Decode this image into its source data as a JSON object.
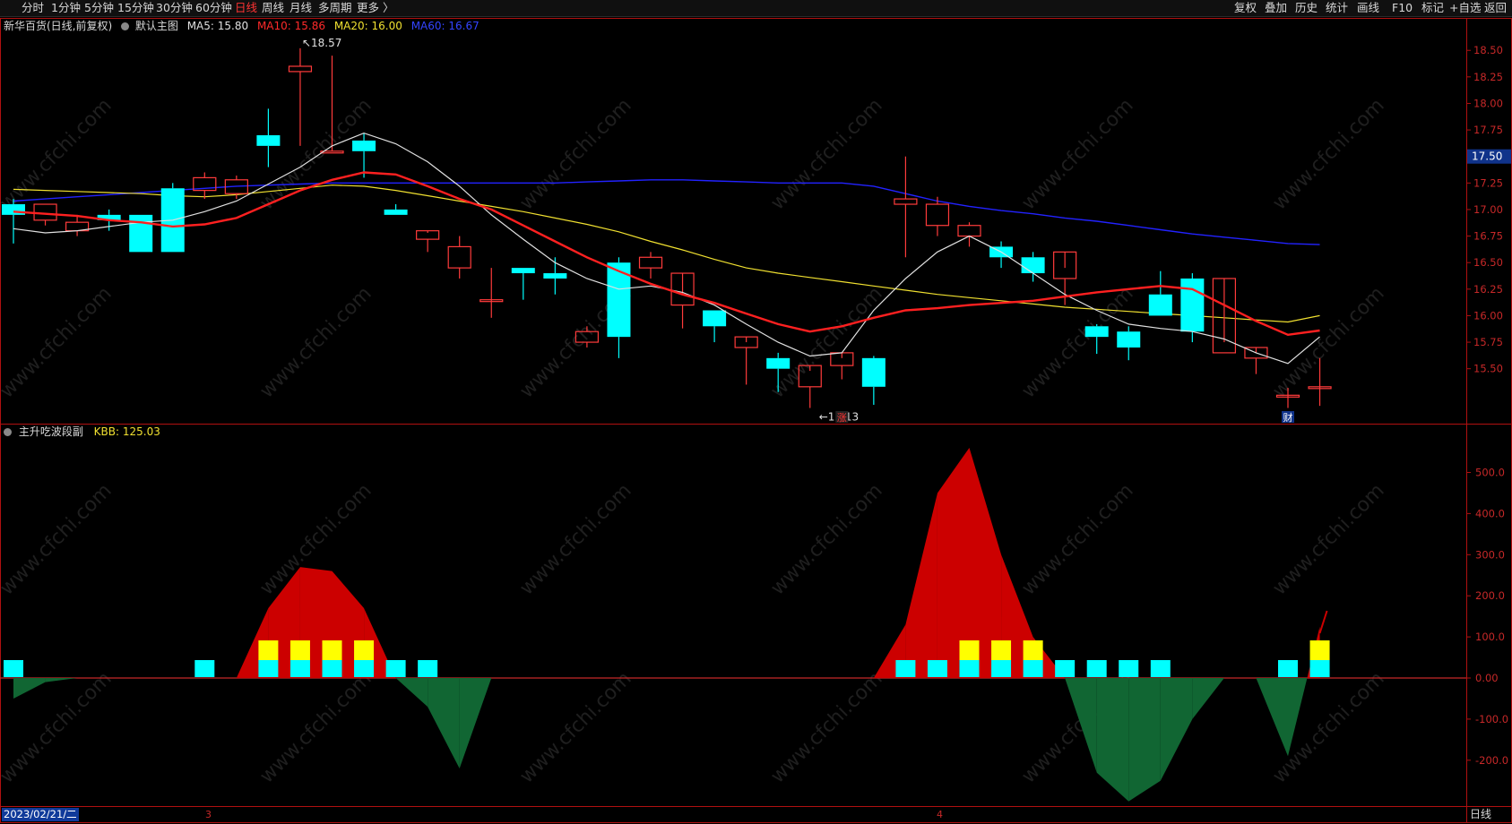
{
  "toolbar": {
    "left_items": [
      "分时",
      "1分钟",
      "5分钟",
      "15分钟",
      "30分钟",
      "60分钟",
      "日线",
      "周线",
      "月线",
      "多周期",
      "更多 〉"
    ],
    "active_index": 6,
    "right_items": [
      "复权",
      "叠加",
      "历史",
      "统计",
      "画线",
      "F10",
      "标记",
      "+自选",
      "返回"
    ]
  },
  "main_legend": {
    "title": "新华百货(日线,前复权)",
    "template_icon": "circle-icon",
    "template": "默认主图",
    "ma5": "MA5: 15.80",
    "ma10": "MA10: 15.86",
    "ma20": "MA20: 16.00",
    "ma60": "MA60: 16.67"
  },
  "sub_legend": {
    "name": "主升吃波段副",
    "kbb": "KBB: 125.03"
  },
  "colors": {
    "up": "#ff3b3b",
    "down": "#00ffff",
    "ma5": "#e0e0e0",
    "ma10": "#ff2020",
    "ma20": "#f0e030",
    "ma60": "#2222ff",
    "axis": "#b01010",
    "hist_pos": "#cc0000",
    "hist_neg": "#116633",
    "bar_yellow": "#ffff00",
    "price_tag_bg": "#10338a"
  },
  "annotations": {
    "high": "18.57",
    "low": "15.13",
    "zhang": "涨",
    "cai": "财",
    "last_price": "17.50"
  },
  "axis": {
    "main_ticks": [
      "18.50",
      "18.25",
      "18.00",
      "17.75",
      "17.50",
      "17.25",
      "17.00",
      "16.75",
      "16.50",
      "16.25",
      "16.00",
      "15.75",
      "15.50"
    ],
    "sub_ticks": [
      "500.0",
      "400.0",
      "300.0",
      "200.0",
      "100.0",
      "0.00",
      "-100.0",
      "-200.0"
    ],
    "months": [
      "3",
      "4"
    ],
    "date": "2023/02/21/二",
    "period": "日线"
  },
  "watermark": "www.cfchi.com",
  "chart_data": {
    "type": "candlestick",
    "open": [
      17.05,
      16.9,
      16.8,
      16.95,
      16.95,
      17.2,
      17.18,
      17.15,
      17.7,
      18.3,
      17.55,
      17.65,
      17.0,
      16.72,
      16.45,
      16.15,
      16.45,
      16.4,
      15.75,
      16.5,
      16.45,
      16.1,
      16.05,
      15.7,
      15.6,
      15.33,
      15.53,
      15.6,
      17.05,
      16.85,
      16.75,
      16.65,
      16.55,
      16.35,
      15.9,
      15.85,
      16.2,
      16.35,
      15.65,
      15.6,
      15.25,
      15.33
    ],
    "close": [
      16.95,
      17.05,
      16.88,
      16.9,
      16.6,
      16.6,
      17.3,
      17.28,
      17.6,
      18.35,
      17.55,
      17.55,
      16.95,
      16.8,
      16.65,
      16.15,
      16.4,
      16.35,
      15.85,
      15.8,
      16.55,
      16.4,
      15.9,
      15.8,
      15.5,
      15.53,
      15.65,
      15.33,
      17.1,
      17.05,
      16.85,
      16.55,
      16.4,
      16.6,
      15.8,
      15.7,
      16.0,
      15.85,
      16.35,
      15.7,
      15.25,
      15.33
    ],
    "high": [
      17.1,
      17.05,
      16.95,
      17.0,
      16.95,
      17.25,
      17.35,
      17.32,
      17.95,
      18.52,
      18.45,
      17.72,
      17.05,
      16.78,
      16.75,
      16.45,
      16.45,
      16.55,
      15.9,
      16.55,
      16.6,
      16.2,
      16.05,
      15.75,
      15.65,
      15.48,
      15.6,
      15.62,
      17.5,
      17.12,
      16.88,
      16.7,
      16.6,
      16.45,
      15.92,
      15.9,
      16.42,
      16.4,
      15.75,
      15.65,
      15.32,
      15.6
    ],
    "low": [
      16.68,
      16.85,
      16.75,
      16.8,
      16.6,
      16.6,
      17.1,
      17.1,
      17.4,
      17.6,
      17.55,
      17.3,
      16.95,
      16.6,
      16.35,
      15.98,
      16.15,
      16.2,
      15.7,
      15.6,
      16.35,
      15.88,
      15.75,
      15.35,
      15.28,
      15.13,
      15.4,
      15.16,
      16.55,
      16.75,
      16.65,
      16.45,
      16.32,
      16.1,
      15.64,
      15.58,
      16.0,
      15.75,
      15.65,
      15.45,
      15.13,
      15.15
    ],
    "ma5": [
      16.82,
      16.78,
      16.8,
      16.84,
      16.88,
      16.9,
      16.98,
      17.08,
      17.24,
      17.4,
      17.6,
      17.72,
      17.62,
      17.45,
      17.22,
      16.95,
      16.72,
      16.5,
      16.35,
      16.25,
      16.28,
      16.22,
      16.1,
      15.92,
      15.75,
      15.62,
      15.65,
      16.05,
      16.35,
      16.6,
      16.75,
      16.6,
      16.4,
      16.2,
      16.05,
      15.92,
      15.88,
      15.85,
      15.78,
      15.65,
      15.55,
      15.8
    ],
    "ma10": [
      16.98,
      16.96,
      16.94,
      16.9,
      16.88,
      16.84,
      16.86,
      16.92,
      17.05,
      17.18,
      17.28,
      17.35,
      17.33,
      17.22,
      17.1,
      17.0,
      16.85,
      16.7,
      16.55,
      16.42,
      16.3,
      16.2,
      16.12,
      16.02,
      15.92,
      15.85,
      15.9,
      15.98,
      16.05,
      16.07,
      16.1,
      16.12,
      16.14,
      16.18,
      16.22,
      16.25,
      16.28,
      16.25,
      16.1,
      15.95,
      15.82,
      15.86
    ],
    "ma20": [
      17.19,
      17.18,
      17.17,
      17.16,
      17.15,
      17.13,
      17.12,
      17.14,
      17.17,
      17.2,
      17.23,
      17.22,
      17.18,
      17.13,
      17.08,
      17.03,
      16.98,
      16.92,
      16.86,
      16.79,
      16.7,
      16.62,
      16.53,
      16.45,
      16.4,
      16.36,
      16.32,
      16.28,
      16.24,
      16.2,
      16.17,
      16.14,
      16.11,
      16.08,
      16.06,
      16.04,
      16.02,
      16.0,
      15.98,
      15.96,
      15.94,
      16.0
    ],
    "ma60": [
      17.08,
      17.1,
      17.12,
      17.14,
      17.16,
      17.18,
      17.2,
      17.22,
      17.23,
      17.24,
      17.25,
      17.25,
      17.25,
      17.25,
      17.25,
      17.25,
      17.25,
      17.25,
      17.26,
      17.27,
      17.28,
      17.28,
      17.27,
      17.26,
      17.25,
      17.25,
      17.25,
      17.22,
      17.15,
      17.08,
      17.03,
      16.99,
      16.96,
      16.92,
      16.89,
      16.85,
      16.81,
      16.77,
      16.74,
      16.71,
      16.68,
      16.67
    ],
    "sub_hist": [
      -50,
      -10,
      0,
      0,
      0,
      0,
      0,
      0,
      170,
      270,
      260,
      170,
      0,
      -70,
      -220,
      0,
      0,
      0,
      0,
      0,
      0,
      0,
      0,
      0,
      0,
      0,
      0,
      0,
      130,
      450,
      560,
      300,
      100,
      0,
      -230,
      -300,
      -250,
      -100,
      0,
      0,
      -190,
      125
    ],
    "sub_cyan": [
      1,
      0,
      0,
      0,
      0,
      0,
      1,
      0,
      1,
      1,
      1,
      1,
      1,
      1,
      0,
      0,
      0,
      0,
      0,
      0,
      0,
      0,
      0,
      0,
      0,
      0,
      0,
      0,
      1,
      1,
      1,
      1,
      1,
      1,
      1,
      1,
      1,
      0,
      0,
      0,
      1,
      1
    ],
    "sub_yellow": [
      0,
      0,
      0,
      0,
      0,
      0,
      0,
      0,
      1,
      1,
      1,
      1,
      0,
      0,
      0,
      0,
      0,
      0,
      0,
      0,
      0,
      0,
      0,
      0,
      0,
      0,
      0,
      0,
      0,
      0,
      1,
      1,
      1,
      0,
      0,
      0,
      0,
      0,
      0,
      0,
      0,
      1
    ],
    "main_ylim": [
      15.05,
      18.62
    ],
    "sub_ylim": [
      -300,
      600
    ],
    "kbb": 125.03
  }
}
